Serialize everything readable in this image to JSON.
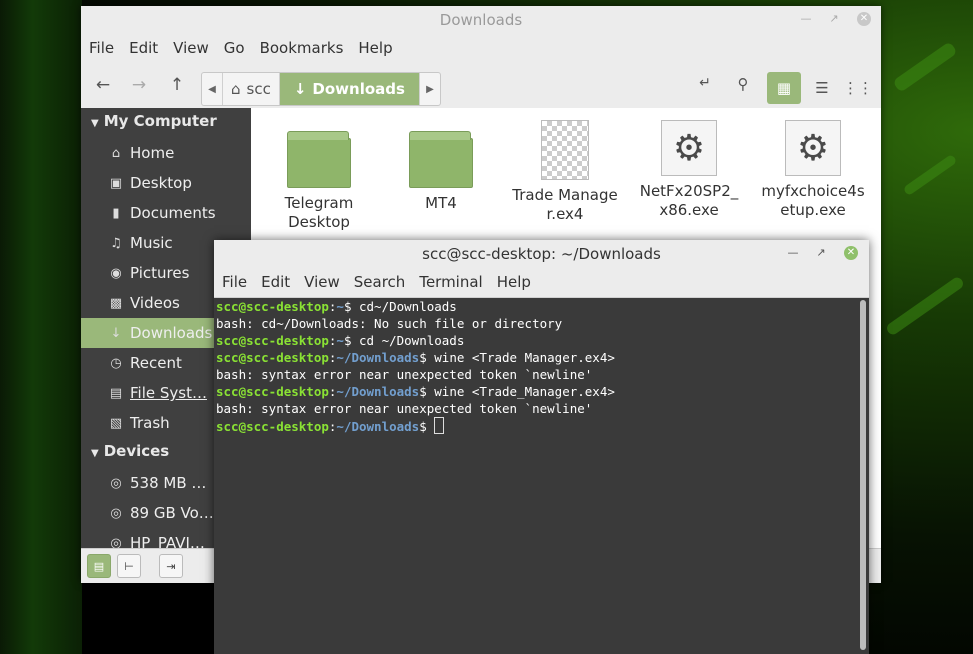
{
  "file_manager": {
    "title": "Downloads",
    "menu": [
      "File",
      "Edit",
      "View",
      "Go",
      "Bookmarks",
      "Help"
    ],
    "breadcrumb": {
      "home": "scc",
      "current": "Downloads"
    },
    "sidebar": {
      "my_computer": "My Computer",
      "items": [
        {
          "label": "Home",
          "icon": "home-icon"
        },
        {
          "label": "Desktop",
          "icon": "desktop-icon"
        },
        {
          "label": "Documents",
          "icon": "document-icon"
        },
        {
          "label": "Music",
          "icon": "music-icon"
        },
        {
          "label": "Pictures",
          "icon": "camera-icon"
        },
        {
          "label": "Videos",
          "icon": "film-icon"
        },
        {
          "label": "Downloads",
          "icon": "download-icon",
          "selected": true
        },
        {
          "label": "Recent",
          "icon": "clock-icon"
        },
        {
          "label": "File Syst…",
          "icon": "drive-icon"
        },
        {
          "label": "Trash",
          "icon": "trash-icon"
        }
      ],
      "devices": "Devices",
      "device_items": [
        {
          "label": "538 MB …",
          "icon": "disk-icon"
        },
        {
          "label": "89 GB Vo…",
          "icon": "disk-icon"
        },
        {
          "label": "HP_PAVI…",
          "icon": "disk-icon"
        }
      ]
    },
    "files": [
      {
        "name": "Telegram Desktop",
        "type": "folder"
      },
      {
        "name": "MT4",
        "type": "folder"
      },
      {
        "name": "Trade Manager.ex4",
        "type": "document"
      },
      {
        "name": "NetFx20SP2_x86.exe",
        "type": "executable"
      },
      {
        "name": "myfxchoice4setup.exe",
        "type": "executable"
      }
    ],
    "colors": {
      "accent": "#9ab87a",
      "sidebar": "#404040"
    }
  },
  "terminal": {
    "title": "scc@scc-desktop: ~/Downloads",
    "menu": [
      "File",
      "Edit",
      "View",
      "Search",
      "Terminal",
      "Help"
    ],
    "lines": [
      {
        "user": "scc@scc-desktop",
        "sep": ":",
        "path": "~",
        "cmd": "$ cd~/Downloads"
      },
      {
        "text": "bash: cd~/Downloads: No such file or directory"
      },
      {
        "user": "scc@scc-desktop",
        "sep": ":",
        "path": "~",
        "cmd": "$ cd ~/Downloads"
      },
      {
        "user": "scc@scc-desktop",
        "sep": ":",
        "path": "~/Downloads",
        "cmd": "$ wine <Trade Manager.ex4>"
      },
      {
        "text": "bash: syntax error near unexpected token `newline'"
      },
      {
        "user": "scc@scc-desktop",
        "sep": ":",
        "path": "~/Downloads",
        "cmd": "$ wine <Trade_Manager.ex4>"
      },
      {
        "text": "bash: syntax error near unexpected token `newline'"
      },
      {
        "user": "scc@scc-desktop",
        "sep": ":",
        "path": "~/Downloads",
        "cmd": "$ ",
        "cursor": true
      }
    ],
    "colors": {
      "user": "#8ae234",
      "path": "#729fcf",
      "background": "#3a3a3a"
    }
  }
}
